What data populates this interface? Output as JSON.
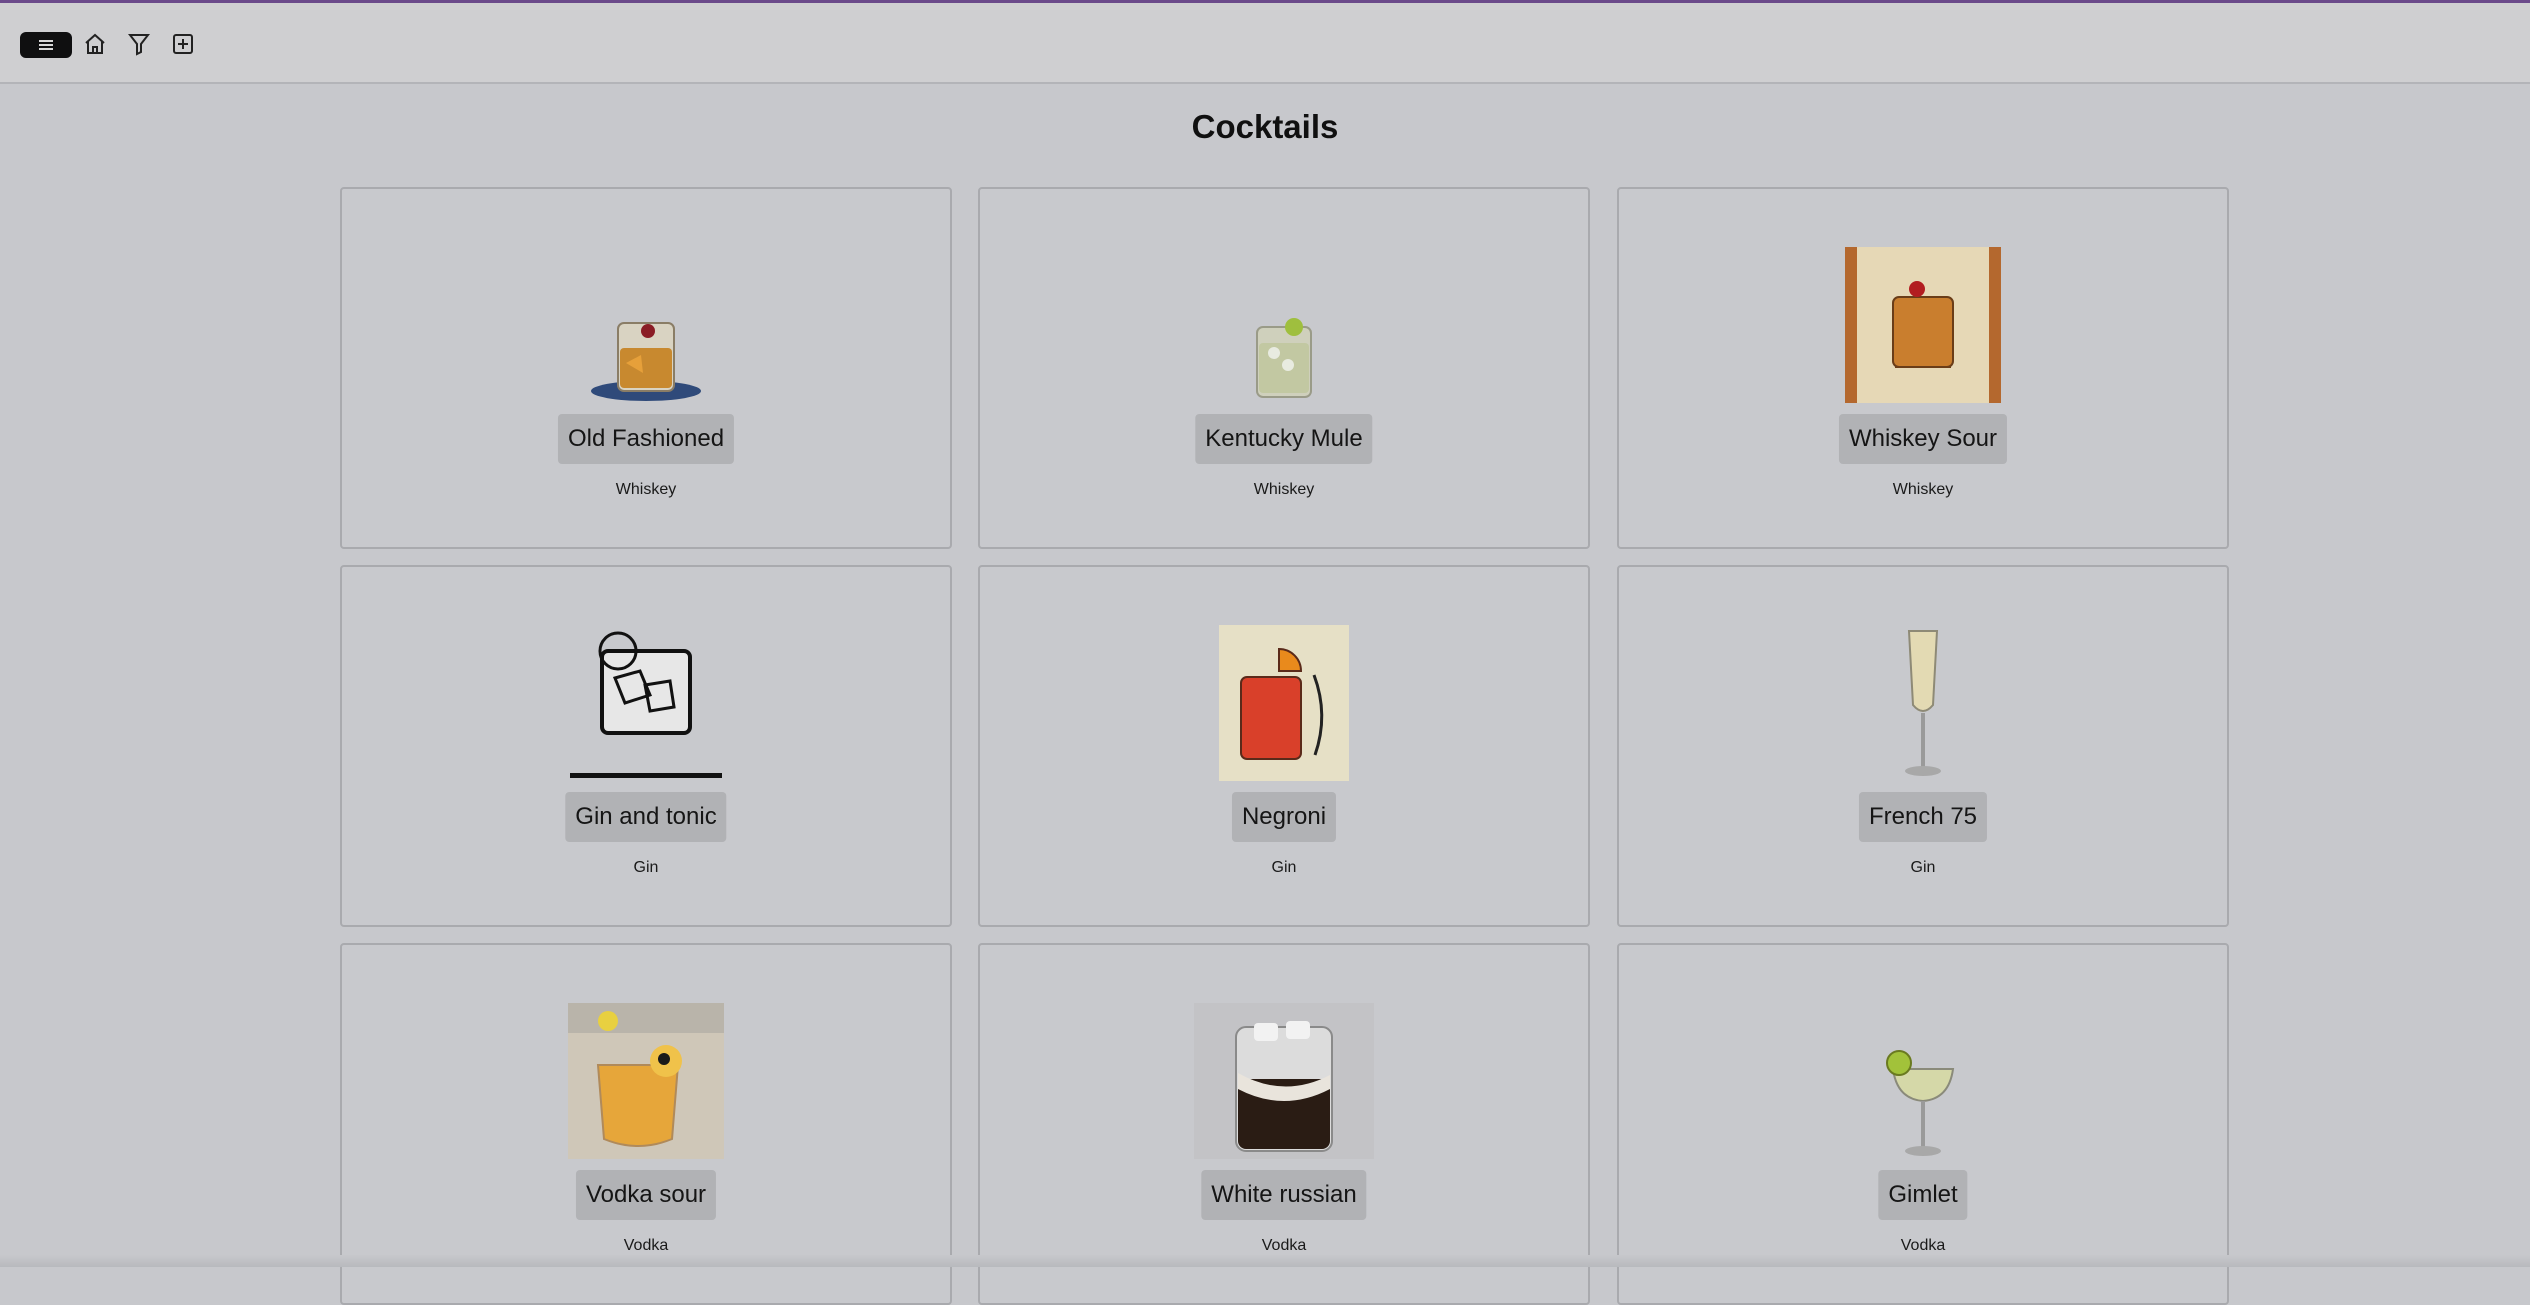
{
  "toolbar": {
    "icons": [
      "menu-icon",
      "home-icon",
      "filter-icon",
      "add-icon"
    ]
  },
  "page": {
    "title": "Cocktails"
  },
  "cocktails": [
    {
      "name": "Old Fashioned",
      "spirit": "Whiskey"
    },
    {
      "name": "Kentucky Mule",
      "spirit": "Whiskey"
    },
    {
      "name": "Whiskey Sour",
      "spirit": "Whiskey"
    },
    {
      "name": "Gin and tonic",
      "spirit": "Gin"
    },
    {
      "name": "Negroni",
      "spirit": "Gin"
    },
    {
      "name": "French 75",
      "spirit": "Gin"
    },
    {
      "name": "Vodka sour",
      "spirit": "Vodka"
    },
    {
      "name": "White russian",
      "spirit": "Vodka"
    },
    {
      "name": "Gimlet",
      "spirit": "Vodka"
    }
  ],
  "colors": {
    "accent_line": "#6b4a8a",
    "background_overlay": "#c7c8cc",
    "menu_button": "#0f0f10"
  }
}
